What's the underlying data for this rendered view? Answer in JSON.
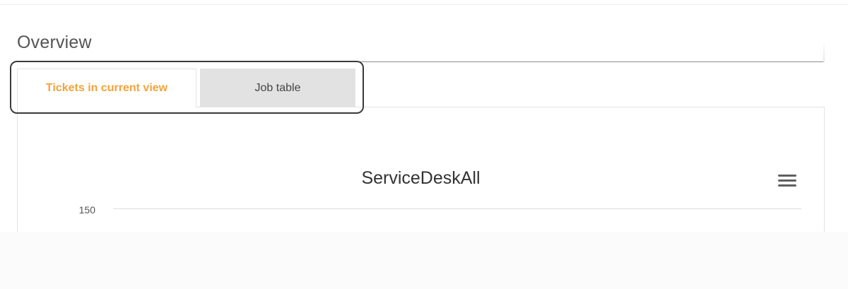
{
  "overview": {
    "title": "Overview"
  },
  "tabs": [
    {
      "label": "Tickets in current view",
      "active": true
    },
    {
      "label": "Job table",
      "active": false
    }
  ],
  "colors": {
    "active_tab_text": "#f5a33a",
    "inactive_tab_bg": "#e2e2e2"
  },
  "chart": {
    "menu_icon": "hamburger-menu-icon"
  },
  "chart_data": {
    "type": "bar",
    "title": "ServiceDeskAll",
    "y_ticks": [
      "150"
    ],
    "grid": true
  }
}
